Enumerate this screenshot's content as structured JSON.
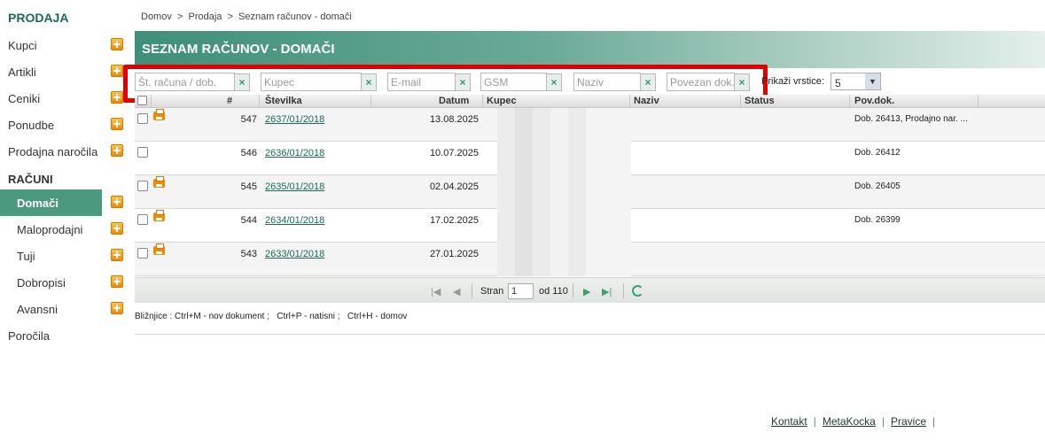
{
  "sidebar": {
    "section_sales": "PRODAJA",
    "items": [
      {
        "label": "Kupci"
      },
      {
        "label": "Artikli"
      },
      {
        "label": "Ceniki"
      },
      {
        "label": "Ponudbe"
      },
      {
        "label": "Prodajna naročila"
      }
    ],
    "section_invoices": "RAČUNI",
    "sub_items": [
      {
        "label": "Domači",
        "active": true
      },
      {
        "label": "Maloprodajni"
      },
      {
        "label": "Tuji"
      },
      {
        "label": "Dobropisi"
      },
      {
        "label": "Avansni"
      }
    ],
    "reports": "Poročila"
  },
  "breadcrumb": "Domov  >  Prodaja  >  Seznam računov - domači",
  "page_title": "SEZNAM RAČUNOV - DOMAČI",
  "filters": {
    "invoice_no_placeholder": "Št. računa / dob.",
    "customer_placeholder": "Kupec",
    "email_placeholder": "E-mail",
    "gsm_placeholder": "GSM",
    "name_placeholder": "Naziv",
    "linked_doc_placeholder": "Povezan dok.",
    "clear_symbol": "×"
  },
  "rows_per_page": {
    "label": "Prikaži vrstice:",
    "value": "5"
  },
  "table": {
    "columns": [
      "#",
      "Številka",
      "Datum",
      "Kupec",
      "Naziv",
      "Status",
      "Pov.dok."
    ],
    "rows": [
      {
        "num": "547",
        "number": "2637/01/2018",
        "date": "13.08.2025",
        "pov": "Dob. 26413, Prodajno nar. ...",
        "print": true
      },
      {
        "num": "546",
        "number": "2636/01/2018",
        "date": "10.07.2025",
        "pov": "Dob. 26412",
        "print": false
      },
      {
        "num": "545",
        "number": "2635/01/2018",
        "date": "02.04.2025",
        "pov": "Dob. 26405",
        "print": true
      },
      {
        "num": "544",
        "number": "2634/01/2018",
        "date": "17.02.2025",
        "pov": "Dob. 26399",
        "print": true
      },
      {
        "num": "543",
        "number": "2633/01/2018",
        "date": "27.01.2025",
        "pov": "",
        "print": true
      }
    ]
  },
  "pager": {
    "page_label": "Stran",
    "page": "1",
    "of_label": "od 110"
  },
  "shortcuts": "Bližnjice : Ctrl+M - nov dokument ;   Ctrl+P - natisni ;   Ctrl+H - domov",
  "footer": {
    "links": [
      "Kontakt",
      "MetaKocka",
      "Pravice"
    ],
    "pipe": "|"
  },
  "colors": {
    "brand_green": "#3f8f78",
    "highlight_red": "#e00000",
    "plus_orange": "#f08a00"
  },
  "icons": [
    "plus-icon",
    "printer-icon",
    "clear-icon",
    "first-page-icon",
    "prev-page-icon",
    "next-page-icon",
    "last-page-icon",
    "refresh-icon",
    "dropdown-arrow-icon"
  ]
}
